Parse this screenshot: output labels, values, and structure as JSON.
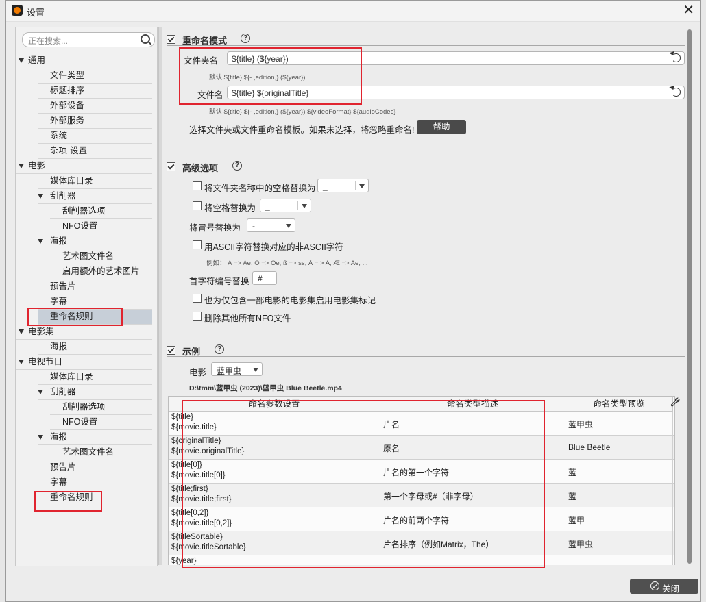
{
  "window": {
    "title": "设置"
  },
  "search": {
    "placeholder": "正在搜索..."
  },
  "tree": [
    {
      "label": "通用",
      "level": 0,
      "expanded": true
    },
    {
      "label": "文件类型",
      "level": 1
    },
    {
      "label": "标题排序",
      "level": 1
    },
    {
      "label": "外部设备",
      "level": 1
    },
    {
      "label": "外部服务",
      "level": 1
    },
    {
      "label": "系统",
      "level": 1
    },
    {
      "label": "杂项-设置",
      "level": 1
    },
    {
      "label": "电影",
      "level": 0,
      "expanded": true
    },
    {
      "label": "媒体库目录",
      "level": 1
    },
    {
      "label": "刮削器",
      "level": 1,
      "expanded": true
    },
    {
      "label": "刮削器选项",
      "level": 2
    },
    {
      "label": "NFO设置",
      "level": 2
    },
    {
      "label": "海报",
      "level": 1,
      "expanded": true
    },
    {
      "label": "艺术图文件名",
      "level": 2
    },
    {
      "label": "启用额外的艺术图片",
      "level": 2
    },
    {
      "label": "预告片",
      "level": 1
    },
    {
      "label": "字幕",
      "level": 1
    },
    {
      "label": "重命名规则",
      "level": 1,
      "selected": true
    },
    {
      "label": "电影集",
      "level": 0,
      "expanded": true
    },
    {
      "label": "海报",
      "level": 1
    },
    {
      "label": "电视节目",
      "level": 0,
      "expanded": true
    },
    {
      "label": "媒体库目录",
      "level": 1
    },
    {
      "label": "刮削器",
      "level": 1,
      "expanded": true
    },
    {
      "label": "刮削器选项",
      "level": 2
    },
    {
      "label": "NFO设置",
      "level": 2
    },
    {
      "label": "海报",
      "level": 1,
      "expanded": true
    },
    {
      "label": "艺术图文件名",
      "level": 2
    },
    {
      "label": "预告片",
      "level": 1
    },
    {
      "label": "字幕",
      "level": 1
    },
    {
      "label": "重命名规则",
      "level": 1
    }
  ],
  "rename": {
    "title": "重命名模式",
    "folder_label": "文件夹名",
    "folder_value": "${title} (${year})",
    "folder_default": "默认   ${title} ${- ,edition,} (${year})",
    "file_label": "文件名",
    "file_value": "${title} ${originalTitle}",
    "file_default": "默认   ${title} ${- ,edition,} (${year}) ${videoFormat} ${audioCodec}",
    "info": "选择文件夹或文件重命名模板。如果未选择，将忽略重命名!",
    "help_button": "帮助"
  },
  "advanced": {
    "title": "高级选项",
    "opt1_label": "将文件夹名称中的空格替换为",
    "opt1_value": "_",
    "opt1_checked": false,
    "opt2_label": "将空格替换为",
    "opt2_value": "_",
    "opt2_checked": false,
    "colon_label": "将冒号替换为",
    "colon_value": "-",
    "ascii_label": "用ASCII字符替换对应的非ASCII字符",
    "ascii_checked": false,
    "ascii_example": "例如：  Ä => Ae; Ö => Oe; ß => ss; Å = > A; Æ => Ae; ...",
    "first_char_label": "首字符编号替换",
    "first_char_value": "#",
    "collection_label": "也为仅包含一部电影的电影集启用电影集标记",
    "collection_checked": false,
    "delete_nfo_label": "删除其他所有NFO文件",
    "delete_nfo_checked": false
  },
  "example": {
    "title": "示例",
    "movie_label": "电影",
    "movie_value": "蓝甲虫",
    "path": "D:\\tmm\\蓝甲虫 (2023)\\蓝甲虫 Blue Beetle.mp4",
    "columns": [
      "命名参数设置",
      "命名类型描述",
      "命名类型预览"
    ],
    "rows": [
      {
        "param1": "${title}",
        "param2": "${movie.title}",
        "desc": "片名",
        "preview": "蓝甲虫"
      },
      {
        "param1": "${originalTitle}",
        "param2": "${movie.originalTitle}",
        "desc": "原名",
        "preview": "Blue Beetle"
      },
      {
        "param1": "${title[0]}",
        "param2": "${movie.title[0]}",
        "desc": "片名的第一个字符",
        "preview": "蓝"
      },
      {
        "param1": "${title;first}",
        "param2": "${movie.title;first}",
        "desc": "第一个字母或#（非字母）",
        "preview": "蓝"
      },
      {
        "param1": "${title[0,2]}",
        "param2": "${movie.title[0,2]}",
        "desc": "片名的前两个字符",
        "preview": "蓝甲"
      },
      {
        "param1": "${titleSortable}",
        "param2": "${movie.titleSortable}",
        "desc": "片名排序（例如Matrix，The）",
        "preview": "蓝甲虫"
      },
      {
        "param1": "${year}",
        "param2": "",
        "desc": "",
        "preview": ""
      }
    ]
  },
  "footer": {
    "close_button": "关闭"
  },
  "colors": {
    "highlight_box": "#e0242f",
    "selection": "#c7cfd8",
    "dark_button": "#4a4a4a"
  }
}
